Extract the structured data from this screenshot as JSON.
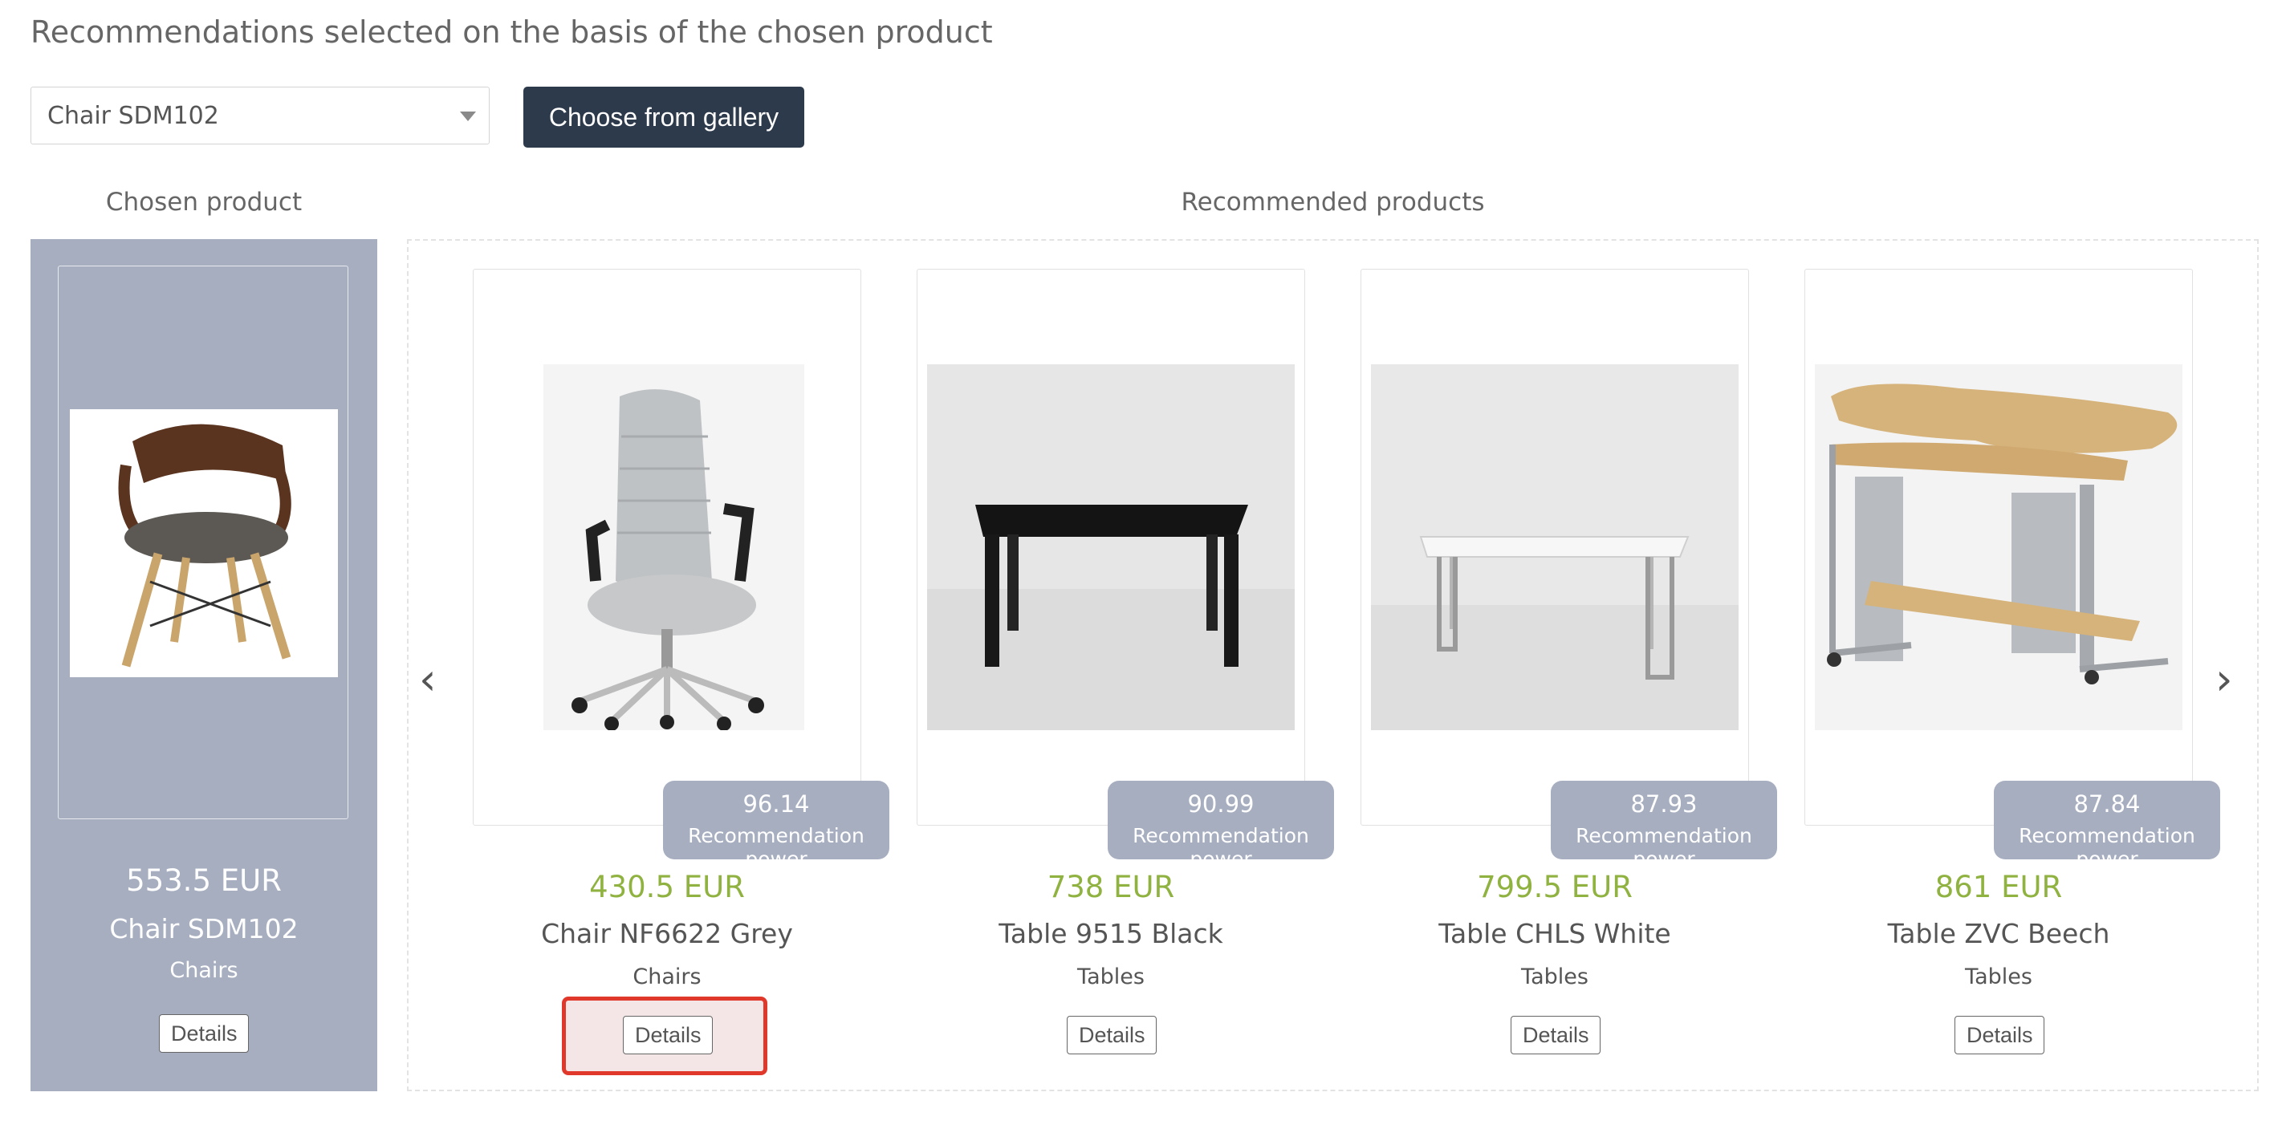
{
  "header": {
    "title": "Recommendations selected on the basis of the chosen product"
  },
  "controls": {
    "selected_product": "Chair SDM102",
    "gallery_button": "Choose from gallery"
  },
  "chosen_section": {
    "title": "Chosen product",
    "product": {
      "price": "553.5 EUR",
      "name": "Chair SDM102",
      "category": "Chairs",
      "details_label": "Details"
    }
  },
  "recommended_section": {
    "title": "Recommended products",
    "prev_arrow": "‹",
    "next_arrow": "›",
    "items": [
      {
        "score": "96.14",
        "score_label": "Recommendation power",
        "price": "430.5 EUR",
        "name": "Chair NF6622 Grey",
        "category": "Chairs",
        "details_label": "Details"
      },
      {
        "score": "90.99",
        "score_label": "Recommendation power",
        "price": "738 EUR",
        "name": "Table 9515 Black",
        "category": "Tables",
        "details_label": "Details"
      },
      {
        "score": "87.93",
        "score_label": "Recommendation power",
        "price": "799.5 EUR",
        "name": "Table CHLS White",
        "category": "Tables",
        "details_label": "Details"
      },
      {
        "score": "87.84",
        "score_label": "Recommendation power",
        "price": "861 EUR",
        "name": "Table ZVC Beech",
        "category": "Tables",
        "details_label": "Details"
      }
    ]
  },
  "colors": {
    "panel": "#a6aec0",
    "button_dark": "#2d3a4c",
    "price_green": "#8fb241",
    "highlight_red": "#e0392b"
  }
}
